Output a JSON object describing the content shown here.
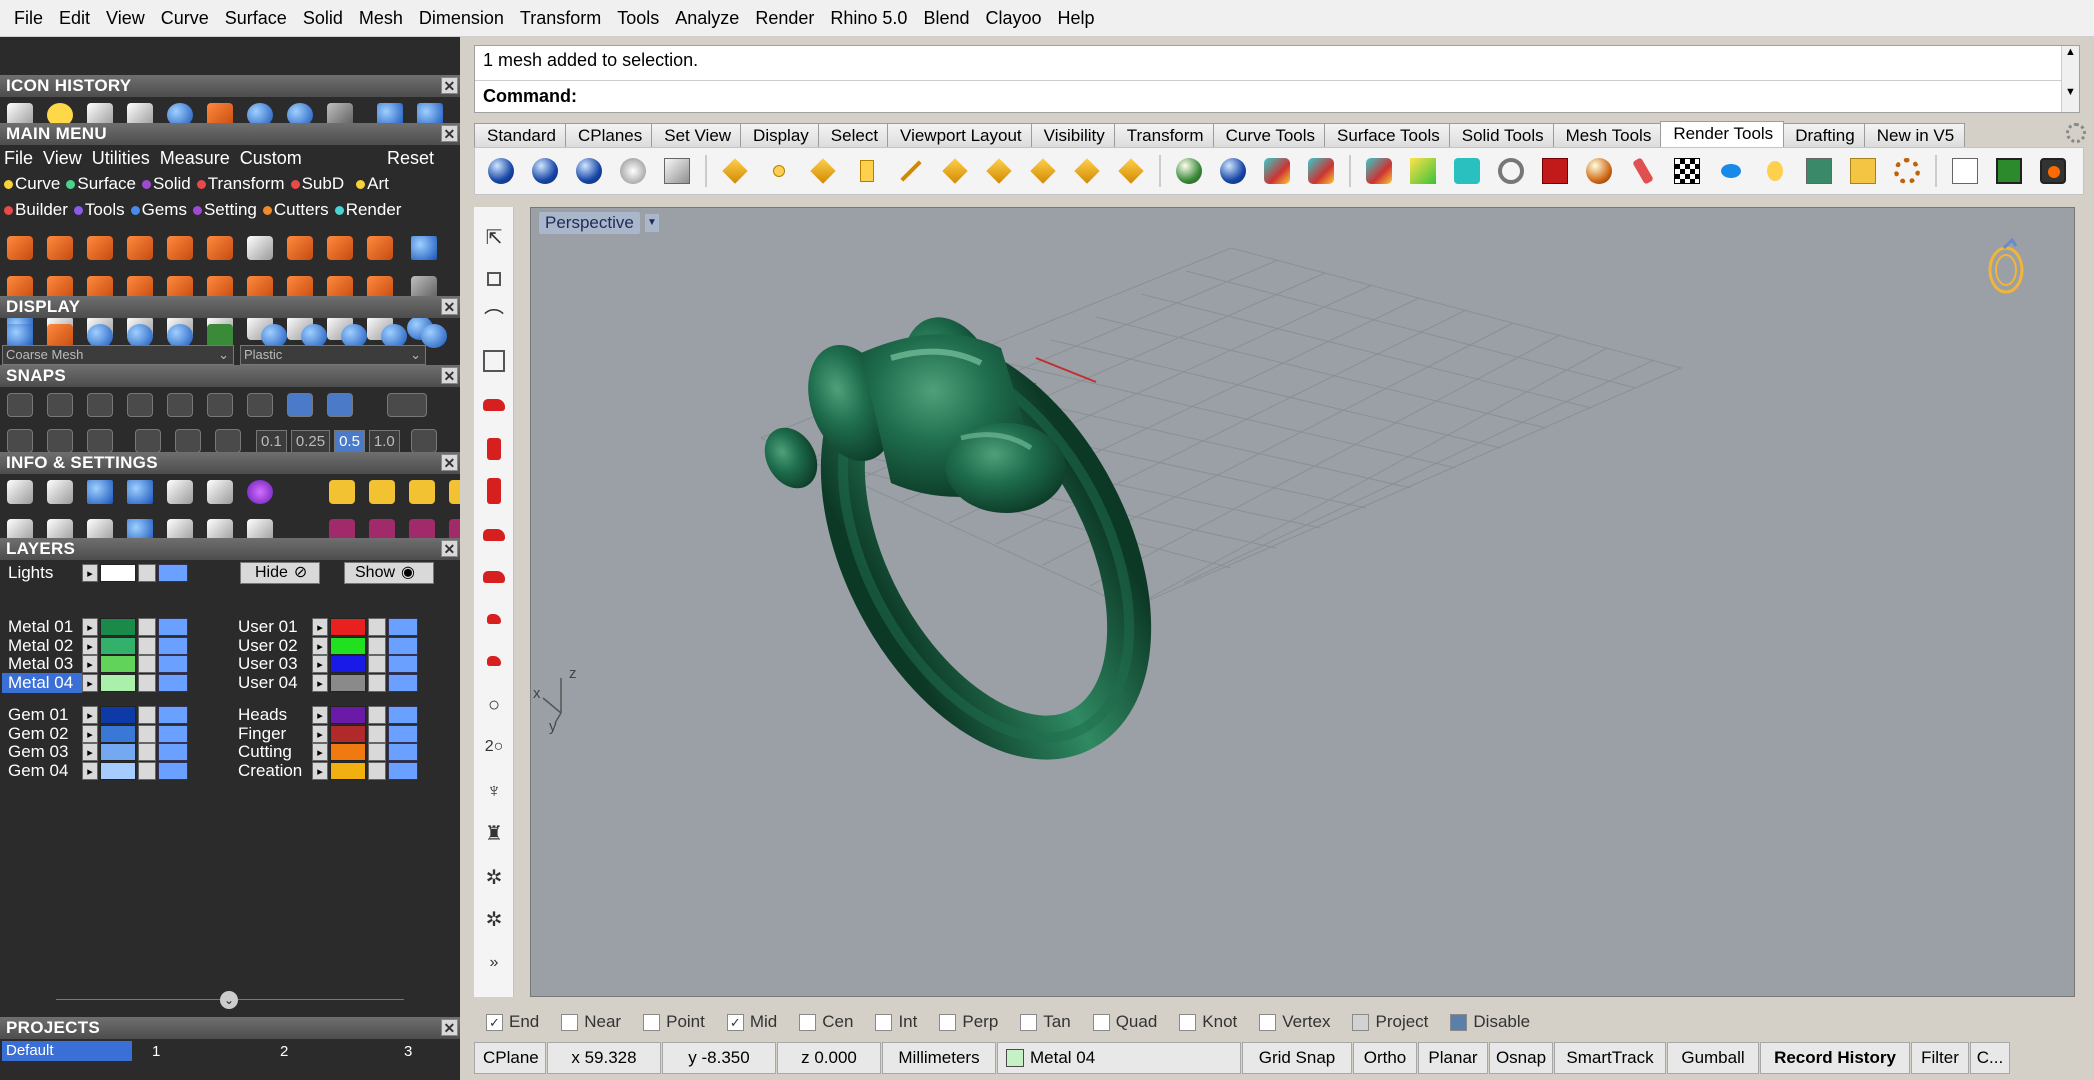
{
  "menubar": [
    "File",
    "Edit",
    "View",
    "Curve",
    "Surface",
    "Solid",
    "Mesh",
    "Dimension",
    "Transform",
    "Tools",
    "Analyze",
    "Render",
    "Rhino 5.0",
    "Blend",
    "Clayoo",
    "Help"
  ],
  "panels": {
    "icon_history": "ICON HISTORY",
    "main_menu": "MAIN MENU",
    "display": "DISPLAY",
    "snaps": "SNAPS",
    "info_settings": "INFO & SETTINGS",
    "layers": "LAYERS",
    "projects": "PROJECTS"
  },
  "main_menu": {
    "row1": [
      "File",
      "View",
      "Utilities",
      "Measure",
      "Custom"
    ],
    "reset": "Reset",
    "row2": [
      "Curve",
      "Surface",
      "Solid",
      "Transform",
      "SubD",
      "Art"
    ],
    "row3": [
      "Builder",
      "Tools",
      "Gems",
      "Setting",
      "Cutters",
      "Render"
    ]
  },
  "display": {
    "mesh_select": "Coarse Mesh",
    "material_select": "Plastic"
  },
  "snaps_values": [
    "0.1",
    "0.25",
    "0.5",
    "1.0"
  ],
  "layers": {
    "lights": "Lights",
    "hide": "Hide",
    "show": "Show",
    "left": [
      {
        "name": "Metal 01",
        "color": "#1a8a4a"
      },
      {
        "name": "Metal 02",
        "color": "#33b06a"
      },
      {
        "name": "Metal 03",
        "color": "#62d35a"
      },
      {
        "name": "Metal 04",
        "color": "#aaf0aa"
      },
      {
        "name": "Gem 01",
        "color": "#0d3aa6"
      },
      {
        "name": "Gem 02",
        "color": "#3a78d8"
      },
      {
        "name": "Gem 03",
        "color": "#74a8f0"
      },
      {
        "name": "Gem 04",
        "color": "#a6ccff"
      }
    ],
    "right": [
      {
        "name": "User 01",
        "color": "#e82020"
      },
      {
        "name": "User 02",
        "color": "#20e020"
      },
      {
        "name": "User 03",
        "color": "#1a1ae8"
      },
      {
        "name": "User 04",
        "color": "#8a8a8a"
      },
      {
        "name": "Heads",
        "color": "#6a1aa6"
      },
      {
        "name": "Finger",
        "color": "#b02a2a"
      },
      {
        "name": "Cutting",
        "color": "#f07a10"
      },
      {
        "name": "Creation",
        "color": "#f0b010"
      }
    ]
  },
  "projects": {
    "selected": "Default",
    "tabs": [
      "1",
      "2",
      "3"
    ]
  },
  "command": {
    "history": "1 mesh added to selection.",
    "label": "Command:",
    "value": ""
  },
  "tabs": [
    "Standard",
    "CPlanes",
    "Set View",
    "Display",
    "Select",
    "Viewport Layout",
    "Visibility",
    "Transform",
    "Curve Tools",
    "Surface Tools",
    "Solid Tools",
    "Mesh Tools",
    "Render Tools",
    "Drafting",
    "New in V5"
  ],
  "active_tab": "Render Tools",
  "viewport": {
    "title": "Perspective",
    "axis_labels": {
      "x": "x",
      "y": "y",
      "z": "z"
    },
    "object_color": "#1f6e4e"
  },
  "osnaps": [
    {
      "label": "End",
      "checked": true
    },
    {
      "label": "Near",
      "checked": false
    },
    {
      "label": "Point",
      "checked": false
    },
    {
      "label": "Mid",
      "checked": true
    },
    {
      "label": "Cen",
      "checked": false
    },
    {
      "label": "Int",
      "checked": false
    },
    {
      "label": "Perp",
      "checked": false
    },
    {
      "label": "Tan",
      "checked": false
    },
    {
      "label": "Quad",
      "checked": false
    },
    {
      "label": "Knot",
      "checked": false
    },
    {
      "label": "Vertex",
      "checked": false
    },
    {
      "label": "Project",
      "checked": false
    },
    {
      "label": "Disable",
      "checked": false
    }
  ],
  "status": {
    "cplane": "CPlane",
    "x": "x 59.328",
    "y": "y -8.350",
    "z": "z 0.000",
    "units": "Millimeters",
    "layer": "Metal 04",
    "grid_snap": "Grid Snap",
    "ortho": "Ortho",
    "planar": "Planar",
    "osnap": "Osnap",
    "smarttrack": "SmartTrack",
    "gumball": "Gumball",
    "record_history": "Record History",
    "filter": "Filter",
    "more": "C..."
  }
}
